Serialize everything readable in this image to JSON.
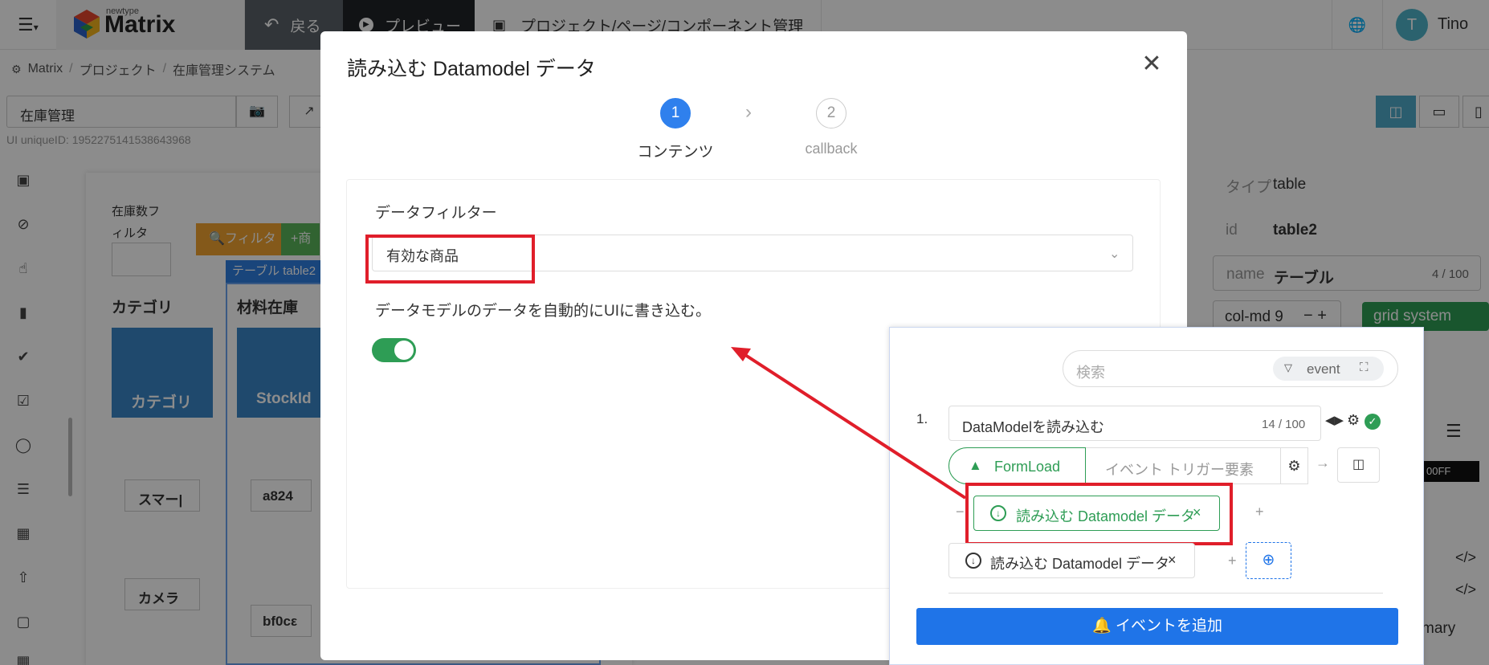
{
  "topbar": {
    "logo_small": "newtype",
    "logo": "Matrix",
    "back_label": "戻る",
    "preview_label": "プレビュー",
    "project_label": "プロジェクト/ページ/コンポーネント管理",
    "user_initial": "T",
    "user_name": "Tino"
  },
  "breadcrumb": [
    "Matrix",
    "プロジェクト",
    "在庫管理システム"
  ],
  "page_name_value": "在庫管理",
  "ui_uniqueid": "UI uniqueID: 1952275141538643968",
  "canvas": {
    "stock_filter_label": "在庫数フィルタ",
    "filter_button": "フィルタ",
    "add_button": "商",
    "table_tag": "テーブル table2",
    "category_title": "カテゴリ",
    "stock_title": "材料在庫",
    "category_col": "カテゴリ",
    "stockid_col": "StockId",
    "cat_row1": "スマー|",
    "cat_row2": "カメラ",
    "stock_row1": "a824",
    "stock_row2": "bf0cε"
  },
  "props": {
    "type_label": "タイプ",
    "type_value": "table",
    "id_label": "id",
    "id_value": "table2",
    "name_label": "name",
    "name_value": "テーブル",
    "name_count": "4 / 100",
    "colmd_value": "col-md 9",
    "grid_label": "grid system",
    "color_value": "00FF",
    "primary_label": "mary"
  },
  "modal": {
    "title": "読み込む Datamodel データ",
    "step1_num": "1",
    "step1_label": "コンテンツ",
    "step2_num": "2",
    "step2_label": "callback",
    "filter_label": "データフィルター",
    "filter_value": "有効な商品",
    "auto_write_label": "データモデルのデータを自動的にUIに書き込む。",
    "auto_write_enabled": true
  },
  "event_panel": {
    "search_placeholder": "検索",
    "filter_label": "event",
    "event_index": "1.",
    "event_name": "DataModelを読み込む",
    "event_name_count": "14 / 100",
    "trigger_tab": "FormLoad",
    "trigger_element_tab": "イベント トリガー要素",
    "action_chip_highlight": "読み込む Datamodel データ",
    "action_chip": "読み込む Datamodel データ",
    "add_event_label": "イベントを追加"
  },
  "colors": {
    "accent_blue": "#1f74e8",
    "green": "#2e9d55",
    "red_highlight": "#e01e2a",
    "teal": "#5ab4c9"
  }
}
